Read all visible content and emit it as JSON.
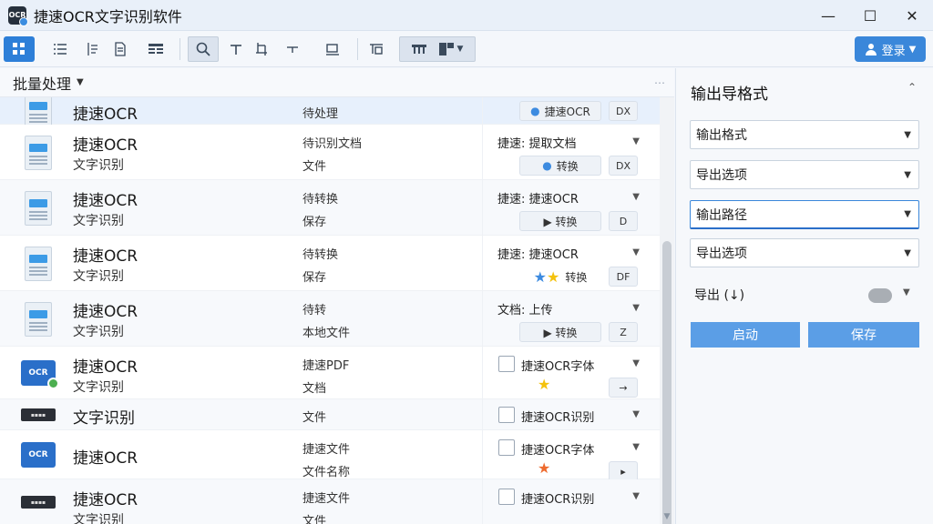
{
  "window": {
    "title": "捷速OCR文字识别软件",
    "icon_label": "OCR",
    "minimize": "—",
    "maximize": "☐",
    "close": "✕"
  },
  "toolbar": {
    "user_button": "登录"
  },
  "left_panel": {
    "header": "批量处理",
    "rows": [
      {
        "icon": "document-icon",
        "name": "捷速OCR",
        "sub": "",
        "col2a": "待处理",
        "col2b": "",
        "col3": "",
        "pill": "捷速OCR",
        "pill_icon": "cloud",
        "btn": "DX",
        "chevron": false
      },
      {
        "icon": "document-icon",
        "name": "捷速OCR",
        "sub": "文字识别",
        "col2a": "待识别文档",
        "col2b": "文件",
        "col3": "捷速: 提取文档",
        "pill": "转换",
        "pill_icon": "cloud",
        "btn": "DX",
        "chevron": true
      },
      {
        "icon": "document-icon",
        "name": "捷速OCR",
        "sub": "文字识别",
        "col2a": "待转换",
        "col2b": "保存",
        "col3": "捷速: 捷速OCR",
        "pill": "▶ 转换",
        "pill_icon": "",
        "btn": "D",
        "chevron": true
      },
      {
        "icon": "document-icon",
        "name": "捷速OCR",
        "sub": "文字识别",
        "col2a": "待转换",
        "col2b": "保存",
        "col3": "捷速: 捷速OCR",
        "pill": "转换",
        "pill_icon": "stars",
        "btn": "DF",
        "chevron": true
      },
      {
        "icon": "document-icon",
        "name": "捷速OCR",
        "sub": "文字识别",
        "col2a": "待转",
        "col2b": "本地文件",
        "col3": "文档: 上传",
        "pill": "▶ 转换",
        "pill_icon": "",
        "btn": "Z",
        "chevron": true
      },
      {
        "icon": "ocr-icon",
        "name": "捷速OCR",
        "sub": "文字识别",
        "col2a": "捷速PDF",
        "col2b": "文档",
        "checkbox": "捷速OCR字体",
        "star": "gold",
        "btn": "→",
        "chevron": true
      },
      {
        "icon": "strip-icon",
        "name": "文字识别",
        "sub": "",
        "col2a": "文件",
        "col2b": "",
        "checkbox": "捷速OCR识别",
        "star": "",
        "btn": "",
        "chevron": true
      },
      {
        "icon": "ocr-icon-plain",
        "name": "捷速OCR",
        "sub": "",
        "col2a": "捷速文件",
        "col2b": "文件名称",
        "checkbox": "捷速OCR字体",
        "star": "orange",
        "btn": "▸",
        "chevron": true
      },
      {
        "icon": "strip-icon",
        "name": "捷速OCR",
        "sub": "文字识别",
        "col2a": "捷速文件",
        "col2b": "文件",
        "checkbox": "捷速OCR识别",
        "star": "",
        "btn": "",
        "chevron": true
      }
    ]
  },
  "right_panel": {
    "title": "输出导格式",
    "dropdowns": [
      "输出格式",
      "导出选项",
      "输出路径",
      "导出选项"
    ],
    "option_label": "导出 (↓)",
    "toggle_on": false,
    "start_button": "启动",
    "save_button": "保存"
  }
}
